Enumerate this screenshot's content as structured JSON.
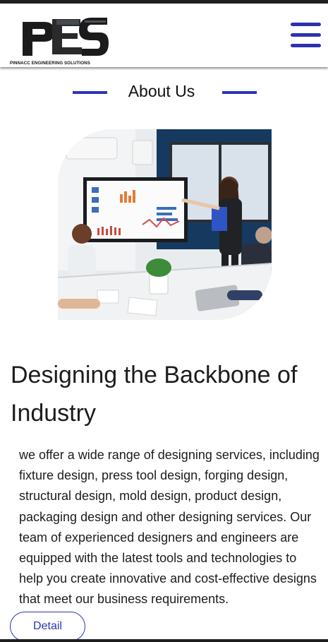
{
  "header": {
    "logo_caption": "PINNACC ENGINEERING SOLUTIONS",
    "menu_icon": "hamburger-menu-icon"
  },
  "about": {
    "title": "About Us",
    "image_alt": "team meeting presentation photo"
  },
  "content": {
    "headline_line1": "Designing the Backbone of",
    "headline_line2": "Industry",
    "body_lines": [
      "we offer a wide range of designing services, including",
      "fixture design, press tool design, forging design,",
      "structural design, mold design, product design,",
      "packaging design and other designing services. Our",
      "team of experienced designers and engineers are",
      "equipped with the latest tools and technologies to",
      "help you create innovative and cost-effective designs",
      "that meet our business requirements."
    ],
    "detail_button": "Detail"
  },
  "colors": {
    "accent": "#2b35b8",
    "text": "#1c1c1c",
    "bar": "#1f1f1f"
  }
}
